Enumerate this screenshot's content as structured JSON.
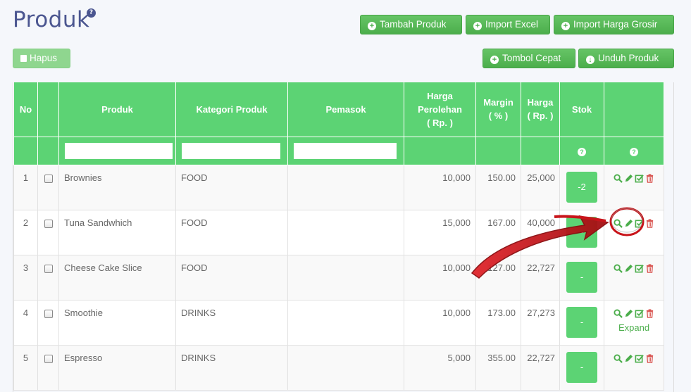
{
  "page": {
    "title": "Produk",
    "help": "?"
  },
  "buttons": {
    "add": "Tambah Produk",
    "import_excel": "Import Excel",
    "import_grosir": "Import Harga Grosir",
    "delete": "Hapus",
    "quick": "Tombol Cepat",
    "download": "Unduh Produk"
  },
  "table": {
    "headers": {
      "no": "No",
      "produk": "Produk",
      "kategori": "Kategori Produk",
      "pemasok": "Pemasok",
      "harga_perolehan": [
        "Harga",
        "Perolehan",
        "( Rp. )"
      ],
      "margin": [
        "Margin",
        "( % )"
      ],
      "harga": [
        "Harga",
        "( Rp. )"
      ],
      "stok": "Stok"
    },
    "filter_help": "?",
    "rows": [
      {
        "no": "1",
        "produk": "Brownies",
        "kategori": "FOOD",
        "pemasok": "",
        "harga_perolehan": "10,000",
        "margin": "150.00",
        "harga": "25,000",
        "stok": "-2"
      },
      {
        "no": "2",
        "produk": "Tuna Sandwhich",
        "kategori": "FOOD",
        "pemasok": "",
        "harga_perolehan": "15,000",
        "margin": "167.00",
        "harga": "40,000",
        "stok": "-"
      },
      {
        "no": "3",
        "produk": "Cheese Cake Slice",
        "kategori": "FOOD",
        "pemasok": "",
        "harga_perolehan": "10,000",
        "margin": "127.00",
        "harga": "22,727",
        "stok": "-"
      },
      {
        "no": "4",
        "produk": "Smoothie",
        "kategori": "DRINKS",
        "pemasok": "",
        "harga_perolehan": "10,000",
        "margin": "173.00",
        "harga": "27,273",
        "stok": "-",
        "expand": "Expand"
      },
      {
        "no": "5",
        "produk": "Espresso",
        "kategori": "DRINKS",
        "pemasok": "",
        "harga_perolehan": "5,000",
        "margin": "355.00",
        "harga": "22,727",
        "stok": "-"
      }
    ]
  },
  "colors": {
    "accent": "#5cd374",
    "title": "#4b5690",
    "delete": "#d9534f",
    "arrow": "#c8141a"
  }
}
